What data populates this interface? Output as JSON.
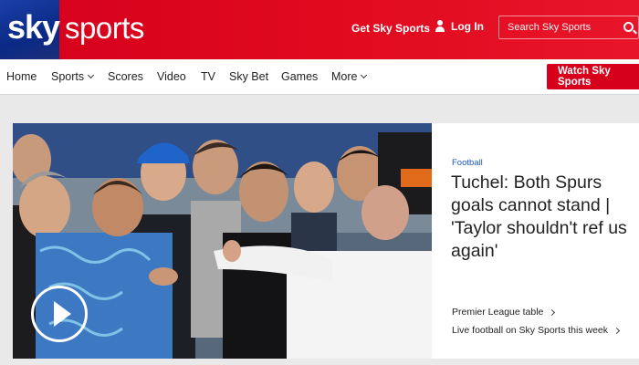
{
  "brand": {
    "sky": "sky",
    "sports": "sports"
  },
  "header": {
    "get_sky": "Get Sky Sports",
    "login": "Log In",
    "search_placeholder": "Search Sky Sports"
  },
  "nav": {
    "items": [
      "Home",
      "Sports",
      "Scores",
      "Video",
      "TV",
      "Sky Bet",
      "Games",
      "More"
    ],
    "watch_label": "Watch Sky Sports"
  },
  "hero": {
    "category": "Football",
    "headline": "Tuchel: Both Spurs goals cannot stand | 'Taylor shouldn't ref us again'",
    "links": [
      "Premier League table",
      "Live football on Sky Sports this week"
    ]
  },
  "colors": {
    "accent": "#d6001c",
    "brand_blue": "#0a2a86",
    "link_blue": "#1a56b8"
  }
}
